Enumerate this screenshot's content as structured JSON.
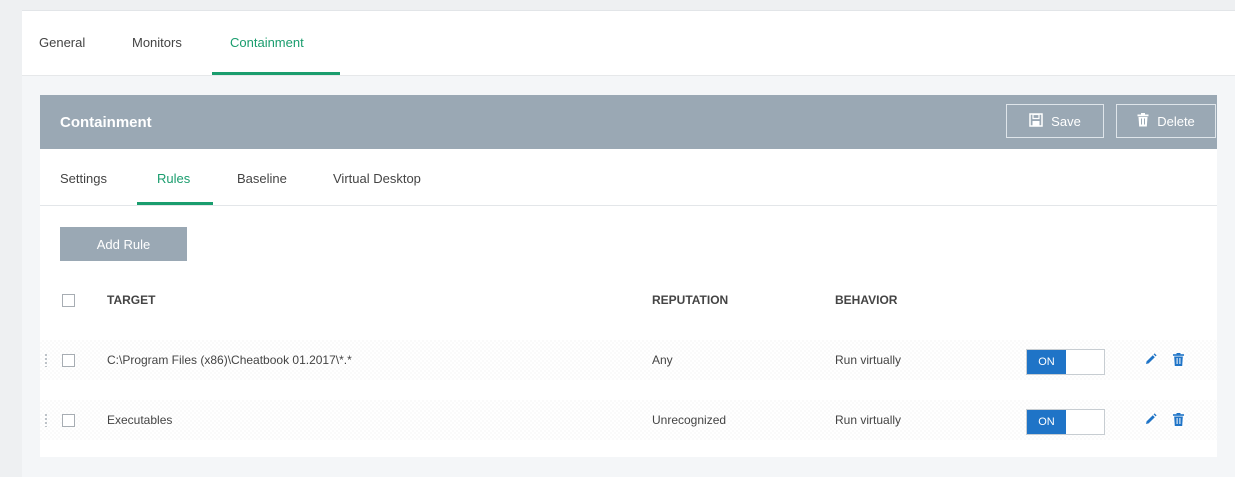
{
  "top_tabs": [
    {
      "label": "General"
    },
    {
      "label": "Monitors"
    },
    {
      "label": "Containment"
    }
  ],
  "panel": {
    "title": "Containment",
    "save_label": "Save",
    "delete_label": "Delete"
  },
  "sub_tabs": [
    {
      "label": "Settings"
    },
    {
      "label": "Rules"
    },
    {
      "label": "Baseline"
    },
    {
      "label": "Virtual Desktop"
    }
  ],
  "add_rule_label": "Add Rule",
  "table": {
    "columns": [
      "TARGET",
      "REPUTATION",
      "BEHAVIOR"
    ],
    "rows": [
      {
        "target": "C:\\Program Files (x86)\\Cheatbook 01.2017\\*.*",
        "reputation": "Any",
        "behavior": "Run virtually",
        "toggle": "ON"
      },
      {
        "target": "Executables",
        "reputation": "Unrecognized",
        "behavior": "Run virtually",
        "toggle": "ON"
      }
    ]
  },
  "icons": {
    "save": "floppy-disk-icon",
    "delete": "trash-icon",
    "edit": "pencil-icon",
    "remove": "trash-icon",
    "drag": "drag-handle-icon"
  },
  "colors": {
    "accent_green": "#1a9d6e",
    "header_gray": "#9aa8b4",
    "toggle_blue": "#1f74c7",
    "action_blue": "#1f74c7"
  }
}
